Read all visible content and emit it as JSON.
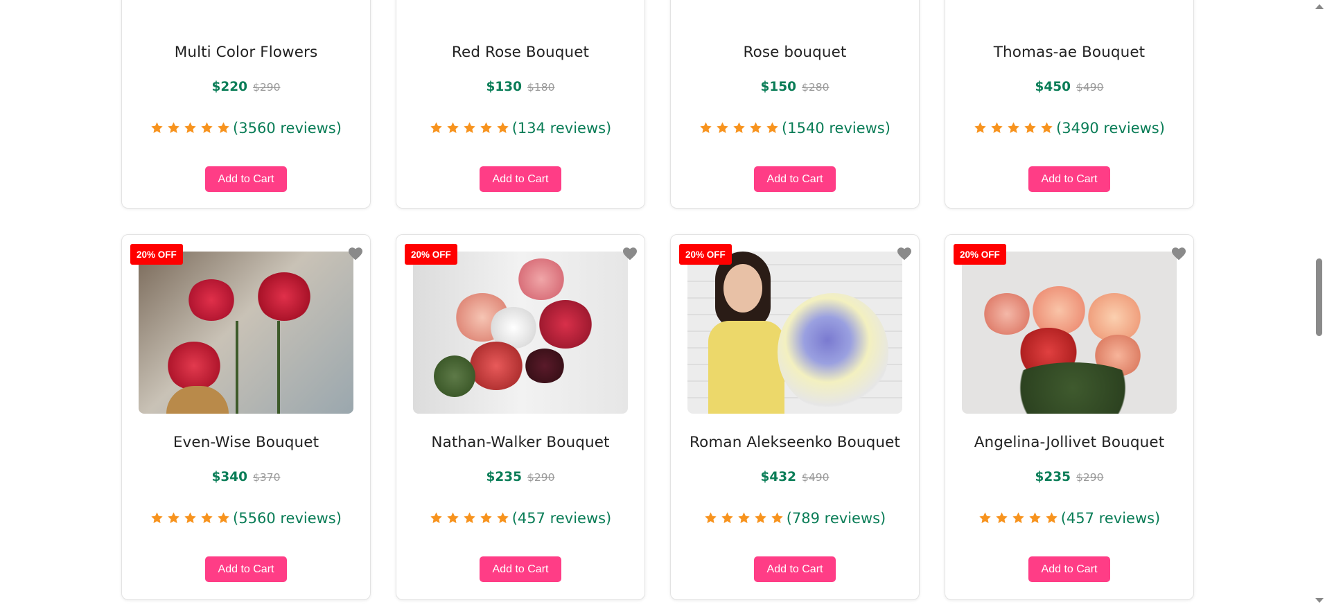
{
  "products_top": [
    {
      "title": "Multi Color Flowers",
      "price": "$220",
      "old_price": "$290",
      "reviews": "(3560 reviews)",
      "cart": "Add to Cart"
    },
    {
      "title": "Red Rose Bouquet",
      "price": "$130",
      "old_price": "$180",
      "reviews": "(134 reviews)",
      "cart": "Add to Cart"
    },
    {
      "title": "Rose bouquet",
      "price": "$150",
      "old_price": "$280",
      "reviews": "(1540 reviews)",
      "cart": "Add to Cart"
    },
    {
      "title": "Thomas-ae Bouquet",
      "price": "$450",
      "old_price": "$490",
      "reviews": "(3490 reviews)",
      "cart": "Add to Cart"
    }
  ],
  "products_bottom": [
    {
      "badge": "20% OFF",
      "title": "Even-Wise Bouquet",
      "price": "$340",
      "old_price": "$370",
      "reviews": "(5560 reviews)",
      "cart": "Add to Cart"
    },
    {
      "badge": "20% OFF",
      "title": "Nathan-Walker Bouquet",
      "price": "$235",
      "old_price": "$290",
      "reviews": "(457 reviews)",
      "cart": "Add to Cart"
    },
    {
      "badge": "20% OFF",
      "title": "Roman Alekseenko Bouquet",
      "price": "$432",
      "old_price": "$490",
      "reviews": "(789 reviews)",
      "cart": "Add to Cart"
    },
    {
      "badge": "20% OFF",
      "title": "Angelina-Jollivet Bouquet",
      "price": "$235",
      "old_price": "$290",
      "reviews": "(457 reviews)",
      "cart": "Add to Cart"
    }
  ],
  "rating_stars": 5,
  "colors": {
    "price": "#0a7d57",
    "star": "#f7931e",
    "cart_button": "#ff3d86",
    "badge": "#ff0000"
  },
  "icons": {
    "star": "star-icon",
    "heart": "heart-icon"
  }
}
